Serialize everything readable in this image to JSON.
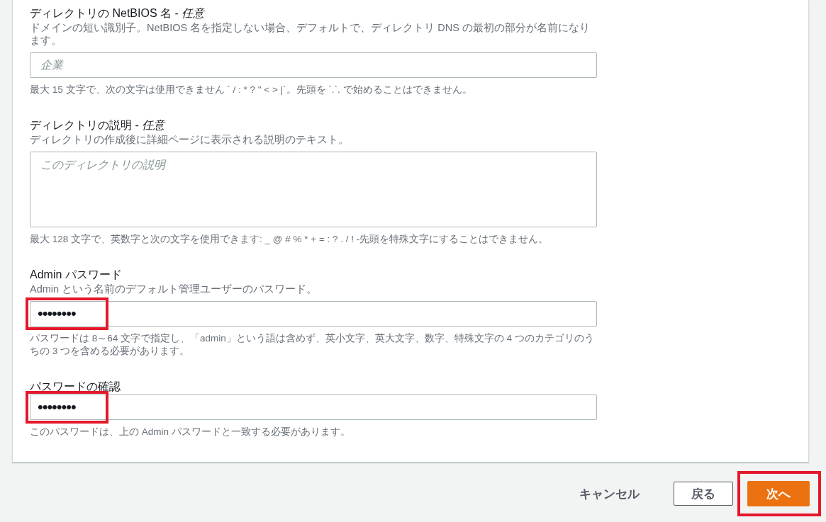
{
  "fields": [
    {
      "kind": "text",
      "label": "ディレクトリの NetBIOS 名 - *任意*",
      "description": "ドメインの短い識別子。NetBIOS 名を指定しない場合、デフォルトで、ディレクトリ DNS の最初の部分が名前になります。",
      "placeholder": "企業",
      "constraint": "最大 15 文字で、次の文字は使用できません ` / : * ? \" < > |`。先頭を `.`. で始めることはできません。",
      "highlighted": false
    },
    {
      "kind": "textarea",
      "label": "ディレクトリの説明 - *任意*",
      "description": "ディレクトリの作成後に詳細ページに表示される説明のテキスト。",
      "placeholder": "このディレクトリの説明",
      "constraint": "最大 128 文字で、英数字と次の文字を使用できます: _ @ # % * + = : ? . / ! -先頭を特殊文字にすることはできません。",
      "highlighted": false
    },
    {
      "kind": "password",
      "label": "Admin パスワード",
      "description": "Admin という名前のデフォルト管理ユーザーのパスワード。",
      "value": "••••••••",
      "constraint": "パスワードは 8～64 文字で指定し、「admin」という語は含めず、英小文字、英大文字、数字、特殊文字の 4 つのカテゴリのうちの 3 つを含める必要があります。",
      "highlighted": true
    },
    {
      "kind": "password",
      "label": "パスワードの確認",
      "value": "••••••••",
      "constraint": "このパスワードは、上の Admin パスワードと一致する必要があります。",
      "highlighted": true
    }
  ],
  "buttons": [
    {
      "kind": "link",
      "label": "キャンセル",
      "highlighted": false
    },
    {
      "kind": "secondary",
      "label": "戻る",
      "highlighted": false
    },
    {
      "kind": "primary",
      "label": "次へ",
      "highlighted": true
    }
  ]
}
